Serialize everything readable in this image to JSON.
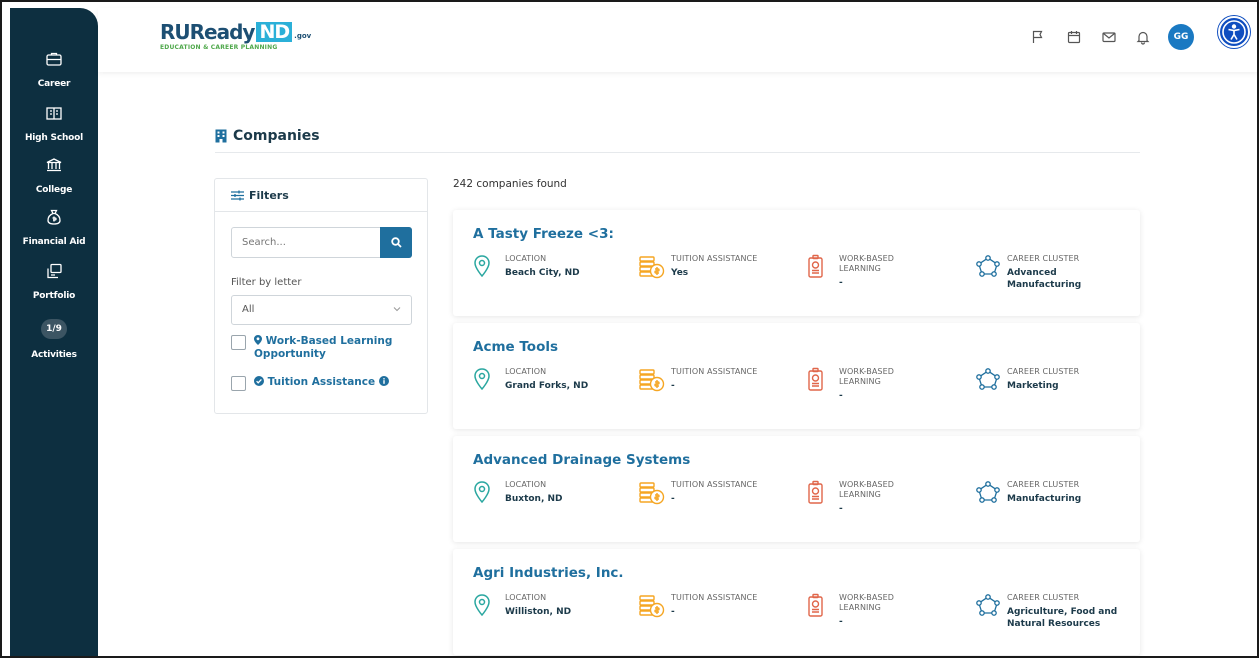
{
  "sidebar": {
    "items": [
      {
        "label": "Career",
        "icon": "briefcase-icon"
      },
      {
        "label": "High School",
        "icon": "school-icon"
      },
      {
        "label": "College",
        "icon": "college-icon"
      },
      {
        "label": "Financial Aid",
        "icon": "money-bag-icon"
      },
      {
        "label": "Portfolio",
        "icon": "portfolio-icon"
      },
      {
        "label": "Activities",
        "badge": "1/9"
      }
    ]
  },
  "header": {
    "logo": {
      "main": "RUReady",
      "state": "ND",
      "suffix": ".gov",
      "tagline": "EDUCATION & CAREER PLANNING"
    },
    "icons": [
      "flag-icon",
      "calendar-icon",
      "mail-icon",
      "bell-icon"
    ],
    "avatar_initials": "GG",
    "accessibility_icon": "accessibility-icon"
  },
  "page": {
    "title": "Companies"
  },
  "filters": {
    "title": "Filters",
    "search_placeholder": "Search...",
    "letter_label": "Filter by letter",
    "letter_value": "All",
    "options": [
      {
        "label": "Work-Based Learning Opportunity",
        "checked": false
      },
      {
        "label": "Tuition Assistance",
        "checked": false
      }
    ]
  },
  "results": {
    "count_text": "242 companies found",
    "labels": {
      "location": "LOCATION",
      "tuition": "TUITION ASSISTANCE",
      "wbl": "WORK-BASED LEARNING",
      "cluster": "CAREER CLUSTER"
    },
    "companies": [
      {
        "name": "A Tasty Freeze <3:",
        "location": "Beach City, ND",
        "tuition": "Yes",
        "wbl": "-",
        "cluster": "Advanced Manufacturing"
      },
      {
        "name": "Acme Tools",
        "location": "Grand Forks, ND",
        "tuition": "-",
        "wbl": "-",
        "cluster": "Marketing"
      },
      {
        "name": "Advanced Drainage Systems",
        "location": "Buxton, ND",
        "tuition": "-",
        "wbl": "-",
        "cluster": "Manufacturing"
      },
      {
        "name": "Agri Industries, Inc.",
        "location": "Williston, ND",
        "tuition": "-",
        "wbl": "-",
        "cluster": "Agriculture, Food and Natural Resources"
      }
    ]
  },
  "colors": {
    "sidebar": "#0d2f40",
    "primary": "#1f6f9e",
    "accent_green": "#4fa84b",
    "accent_orange": "#f5a623",
    "accent_red": "#e0664a",
    "teal": "#2aa7a0"
  }
}
